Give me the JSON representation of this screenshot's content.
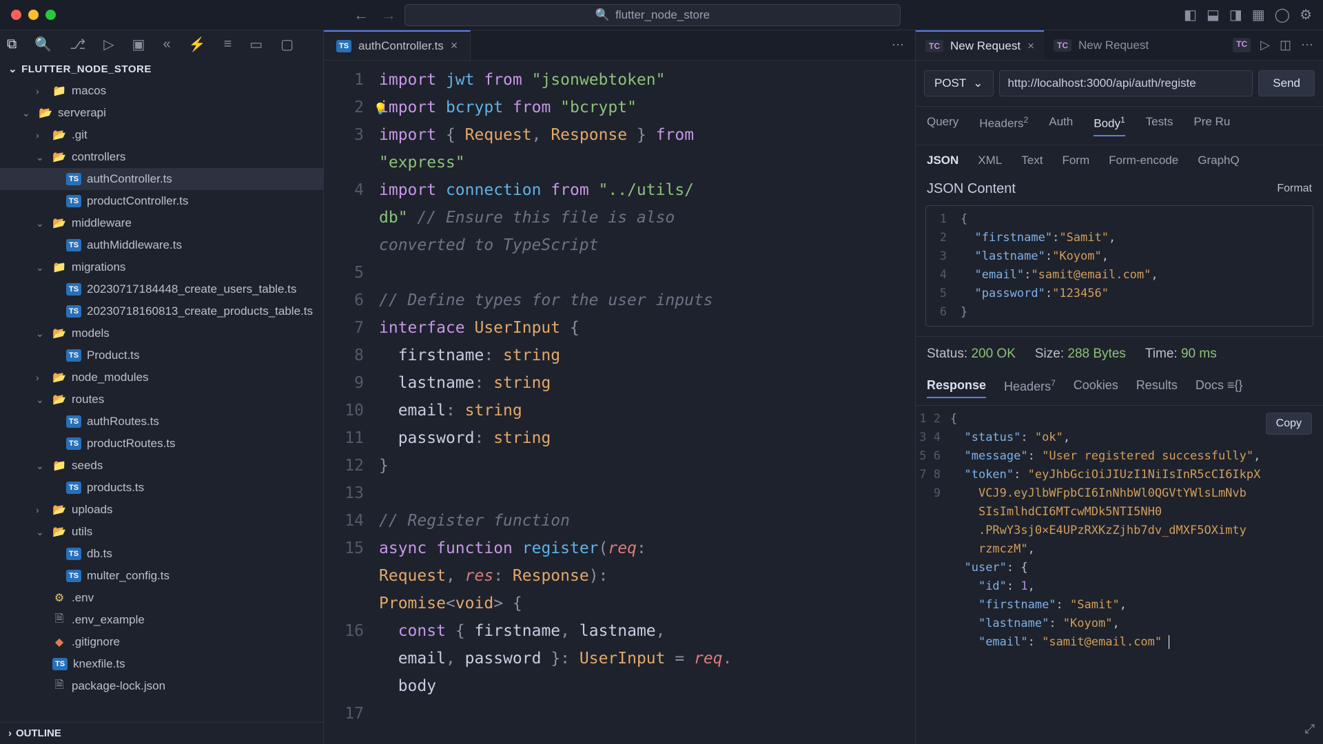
{
  "titlebar": {
    "project": "flutter_node_store"
  },
  "explorer": {
    "header": "FLUTTER_NODE_STORE",
    "outline": "OUTLINE",
    "items": [
      {
        "indent": 2,
        "chev": ">",
        "icon": "folder",
        "label": "macos"
      },
      {
        "indent": 1,
        "chev": "v",
        "icon": "folder-o",
        "label": "serverapi"
      },
      {
        "indent": 2,
        "chev": ">",
        "icon": "folder-g",
        "label": ".git"
      },
      {
        "indent": 2,
        "chev": "v",
        "icon": "folder-o",
        "label": "controllers"
      },
      {
        "indent": 3,
        "chev": "",
        "icon": "ts",
        "label": "authController.ts",
        "selected": true
      },
      {
        "indent": 3,
        "chev": "",
        "icon": "ts",
        "label": "productController.ts"
      },
      {
        "indent": 2,
        "chev": "v",
        "icon": "folder-b",
        "label": "middleware"
      },
      {
        "indent": 3,
        "chev": "",
        "icon": "ts",
        "label": "authMiddleware.ts"
      },
      {
        "indent": 2,
        "chev": "v",
        "icon": "folder",
        "label": "migrations"
      },
      {
        "indent": 3,
        "chev": "",
        "icon": "ts",
        "label": "20230717184448_create_users_table.ts"
      },
      {
        "indent": 3,
        "chev": "",
        "icon": "ts",
        "label": "20230718160813_create_products_table.ts"
      },
      {
        "indent": 2,
        "chev": "v",
        "icon": "folder-red",
        "label": "models"
      },
      {
        "indent": 3,
        "chev": "",
        "icon": "ts",
        "label": "Product.ts"
      },
      {
        "indent": 2,
        "chev": ">",
        "icon": "folder-gr",
        "label": "node_modules"
      },
      {
        "indent": 2,
        "chev": "v",
        "icon": "folder-gr",
        "label": "routes"
      },
      {
        "indent": 3,
        "chev": "",
        "icon": "ts",
        "label": "authRoutes.ts"
      },
      {
        "indent": 3,
        "chev": "",
        "icon": "ts",
        "label": "productRoutes.ts"
      },
      {
        "indent": 2,
        "chev": "v",
        "icon": "folder",
        "label": "seeds"
      },
      {
        "indent": 3,
        "chev": "",
        "icon": "ts",
        "label": "products.ts"
      },
      {
        "indent": 2,
        "chev": ">",
        "icon": "folder-o",
        "label": "uploads"
      },
      {
        "indent": 2,
        "chev": "v",
        "icon": "folder-gr",
        "label": "utils"
      },
      {
        "indent": 3,
        "chev": "",
        "icon": "ts",
        "label": "db.ts"
      },
      {
        "indent": 3,
        "chev": "",
        "icon": "ts",
        "label": "multer_config.ts"
      },
      {
        "indent": 2,
        "chev": "",
        "icon": "env",
        "label": ".env"
      },
      {
        "indent": 2,
        "chev": "",
        "icon": "doc",
        "label": ".env_example"
      },
      {
        "indent": 2,
        "chev": "",
        "icon": "git",
        "label": ".gitignore"
      },
      {
        "indent": 2,
        "chev": "",
        "icon": "ts",
        "label": "knexfile.ts"
      },
      {
        "indent": 2,
        "chev": "",
        "icon": "doc",
        "label": "package-lock.json"
      }
    ]
  },
  "editor": {
    "tab_active": "authController.ts",
    "line_count": 17
  },
  "thunder": {
    "tab1": "New Request",
    "tab2": "New Request",
    "method": "POST",
    "url": "http://localhost:3000/api/auth/registe",
    "send": "Send",
    "reqTabs": {
      "q": "Query",
      "h": "Headers",
      "hSup": "2",
      "a": "Auth",
      "b": "Body",
      "bSup": "1",
      "t": "Tests",
      "p": "Pre Ru"
    },
    "bodyTypes": {
      "json": "JSON",
      "xml": "XML",
      "text": "Text",
      "form": "Form",
      "fe": "Form-encode",
      "gq": "GraphQ"
    },
    "jsonContent": "JSON Content",
    "format": "Format",
    "body": {
      "l1": "{",
      "l2": "  \"firstname\":\"Samit\",",
      "l3": "  \"lastname\":\"Koyom\",",
      "l4": "  \"email\":\"samit@email.com\",",
      "l5": "  \"password\":\"123456\"",
      "l6": "}"
    },
    "status": {
      "sLabel": "Status:",
      "sVal": "200 OK",
      "szLabel": "Size:",
      "szVal": "288 Bytes",
      "tLabel": "Time:",
      "tVal": "90 ms"
    },
    "respTabs": {
      "r": "Response",
      "h": "Headers",
      "hSup": "7",
      "c": "Cookies",
      "res": "Results",
      "d": "Docs"
    },
    "copy": "Copy",
    "resp": {
      "l1": "{",
      "l2": "  \"status\": \"ok\",",
      "l3": "  \"message\": \"User registered successfully\",",
      "l4a": "  \"token\": \"eyJhbGciOiJIUzI1NiIsInR5cCI6IkpX",
      "l4b": "    VCJ9.eyJlbWFpbCI6InNhbWl0QGVtYWlsLmNvb",
      "l4c": "    SIsImlhdCI6MTcwMDk5NTI5NH0",
      "l4d": "    .PRwY3sj0×E4UPzRXKzZjhb7dv_dMXF5OXimty",
      "l4e": "    rzmczM\",",
      "l5": "  \"user\": {",
      "l6": "    \"id\": 1,",
      "l7": "    \"firstname\": \"Samit\",",
      "l8": "    \"lastname\": \"Koyom\",",
      "l9": "    \"email\": \"samit@email.com\""
    }
  }
}
